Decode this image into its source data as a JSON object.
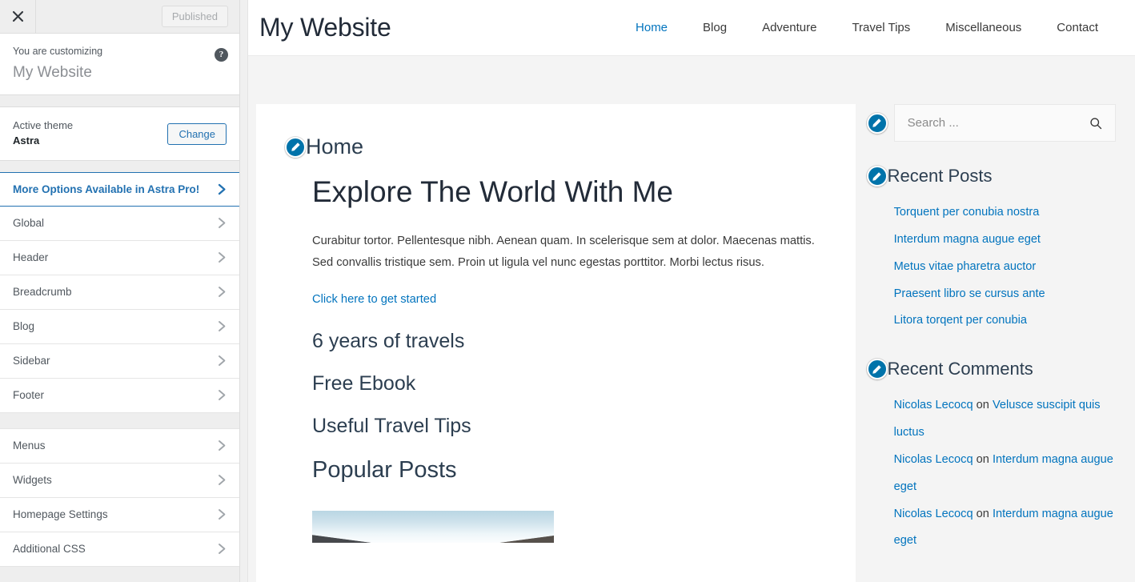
{
  "customizer": {
    "close_icon": "close-icon",
    "publish_label": "Published",
    "customizing_label": "You are customizing",
    "site_title": "My Website",
    "help_icon": "help-icon",
    "active_theme_label": "Active theme",
    "active_theme_name": "Astra",
    "change_label": "Change",
    "pro_row_label": "More Options Available in Astra Pro!",
    "menu_group_1": [
      {
        "label": "Global"
      },
      {
        "label": "Header"
      },
      {
        "label": "Breadcrumb"
      },
      {
        "label": "Blog"
      },
      {
        "label": "Sidebar"
      },
      {
        "label": "Footer"
      }
    ],
    "menu_group_2": [
      {
        "label": "Menus"
      },
      {
        "label": "Widgets"
      },
      {
        "label": "Homepage Settings"
      },
      {
        "label": "Additional CSS"
      }
    ],
    "chevron_icon": "chevron-right-icon",
    "accent_color": "#2271b1"
  },
  "preview": {
    "site_title": "My Website",
    "nav": [
      {
        "label": "Home",
        "active": true
      },
      {
        "label": "Blog",
        "active": false
      },
      {
        "label": "Adventure",
        "active": false
      },
      {
        "label": "Travel Tips",
        "active": false
      },
      {
        "label": "Miscellaneous",
        "active": false
      },
      {
        "label": "Contact",
        "active": false
      }
    ],
    "nav_active_color": "#0274be",
    "content": {
      "page_title": "Home",
      "hero_title": "Explore The World With Me",
      "hero_paragraph": "Curabitur tortor. Pellentesque nibh. Aenean quam. In scelerisque sem at dolor. Maecenas mattis. Sed convallis tristique sem. Proin ut ligula vel nunc egestas porttitor. Morbi lectus risus.",
      "hero_link": "Click here to get started",
      "section_1": "6 years of travels",
      "section_2": "Free Ebook",
      "section_3": "Useful Travel Tips",
      "section_4": "Popular Posts",
      "photo_alt": "landscape-photo"
    },
    "sidebar": {
      "search_placeholder": "Search ...",
      "search_value": "",
      "search_icon": "search-icon",
      "recent_posts_title": "Recent Posts",
      "recent_posts": [
        "Torquent per conubia nostra",
        "Interdum magna augue eget",
        "Metus vitae pharetra auctor",
        "Praesent libro se cursus ante",
        "Litora torqent per conubia"
      ],
      "recent_comments_title": "Recent Comments",
      "recent_comments": [
        {
          "author": "Nicolas Lecocq",
          "on": " on ",
          "post": "Velusce suscipit quis luctus"
        },
        {
          "author": "Nicolas Lecocq",
          "on": " on ",
          "post": "Interdum magna augue eget"
        },
        {
          "author": "Nicolas Lecocq",
          "on": " on ",
          "post": "Interdum magna augue eget"
        }
      ]
    },
    "edit_pin_icon": "edit-pencil-icon",
    "link_color": "#0274be"
  }
}
